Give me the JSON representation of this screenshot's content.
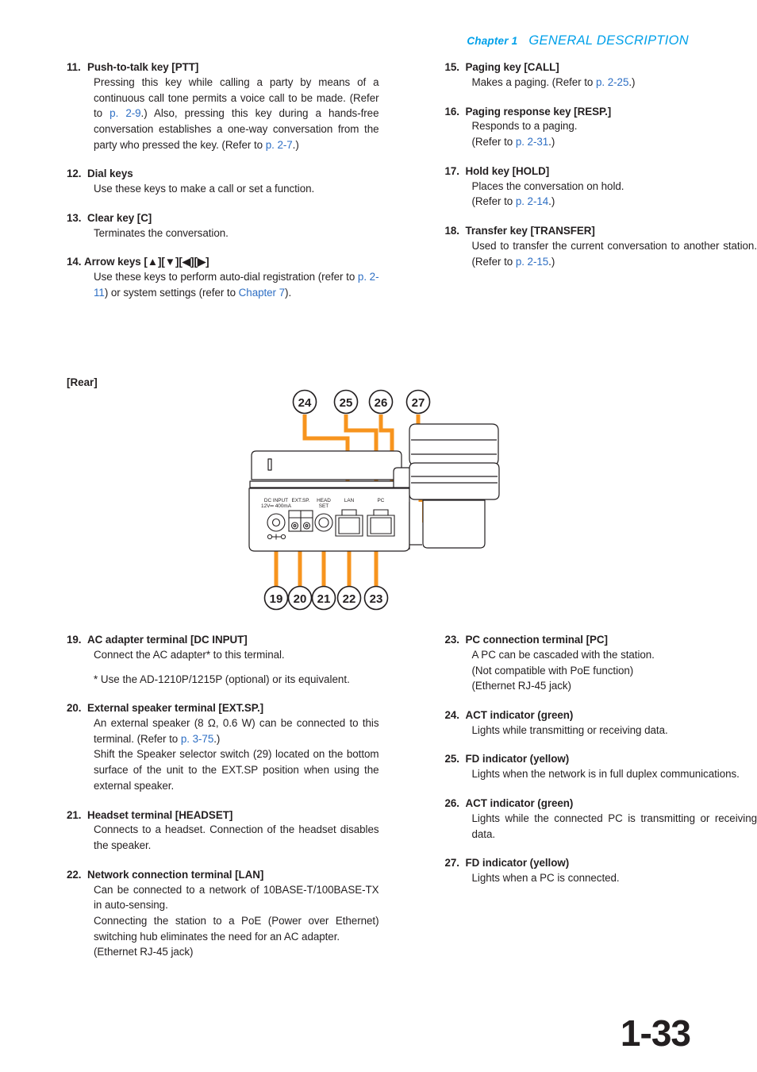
{
  "header": {
    "chapter": "Chapter 1",
    "title": "GENERAL DESCRIPTION"
  },
  "page_number": "1-33",
  "rear_label": "[Rear]",
  "left_column_top": [
    {
      "num": "11.",
      "title": "Push-to-talk key [PTT]",
      "body_parts": [
        {
          "t": "Pressing this key while calling a party by means of a continuous call tone permits a voice call to be made. (Refer to "
        },
        {
          "t": "p. 2-9",
          "link": true
        },
        {
          "t": ".) Also, pressing this key during a hands-free conversation establishes a one-way conversation from the party who pressed the key. (Refer to "
        },
        {
          "t": "p. 2-7",
          "link": true
        },
        {
          "t": ".)"
        }
      ]
    },
    {
      "num": "12.",
      "title": "Dial keys",
      "body_parts": [
        {
          "t": "Use these keys to make a call or set a function."
        }
      ]
    },
    {
      "num": "13.",
      "title": "Clear key [C]",
      "body_parts": [
        {
          "t": "Terminates the conversation."
        }
      ]
    },
    {
      "num": "14.",
      "title": "Arrow keys [▲][▼][◀][▶]",
      "tight": true,
      "body_parts": [
        {
          "t": "Use these keys to perform auto-dial registration (refer to "
        },
        {
          "t": "p. 2-11",
          "link": true
        },
        {
          "t": ") or system settings (refer to "
        },
        {
          "t": "Chapter 7",
          "link": true
        },
        {
          "t": ")."
        }
      ]
    }
  ],
  "right_column_top": [
    {
      "num": "15.",
      "title": "Paging key [CALL]",
      "body_parts": [
        {
          "t": "Makes a paging. (Refer to "
        },
        {
          "t": "p. 2-25",
          "link": true
        },
        {
          "t": ".)"
        }
      ]
    },
    {
      "num": "16.",
      "title": "Paging response key [RESP.]",
      "lines": [
        [
          {
            "t": "Responds to a paging."
          }
        ],
        [
          {
            "t": "(Refer to "
          },
          {
            "t": "p. 2-31",
            "link": true
          },
          {
            "t": ".)"
          }
        ]
      ]
    },
    {
      "num": "17.",
      "title": "Hold key [HOLD]",
      "lines": [
        [
          {
            "t": "Places the conversation on hold."
          }
        ],
        [
          {
            "t": "(Refer to "
          },
          {
            "t": "p. 2-14",
            "link": true
          },
          {
            "t": ".)"
          }
        ]
      ]
    },
    {
      "num": "18.",
      "title": "Transfer key [TRANSFER]",
      "body_parts": [
        {
          "t": "Used to transfer the current conversation to another station. (Refer to "
        },
        {
          "t": "p. 2-15",
          "link": true
        },
        {
          "t": ".)"
        }
      ]
    }
  ],
  "left_column_bottom": [
    {
      "num": "19.",
      "title": "AC adapter terminal [DC INPUT]",
      "body_parts": [
        {
          "t": "Connect the AC adapter* to this terminal."
        }
      ],
      "note": "* Use the AD-1210P/1215P (optional) or its equivalent."
    },
    {
      "num": "20.",
      "title": "External speaker terminal [EXT.SP.]",
      "lines": [
        [
          {
            "t": "An external speaker (8 Ω, 0.6 W) can be connected to this terminal. (Refer to "
          },
          {
            "t": "p. 3-75",
            "link": true
          },
          {
            "t": ".)"
          }
        ],
        [
          {
            "t": "Shift the Speaker selector switch (29) located on the bottom surface of the unit to the EXT.SP position when using the external speaker."
          }
        ]
      ]
    },
    {
      "num": "21.",
      "title": "Headset terminal [HEADSET]",
      "body_parts": [
        {
          "t": "Connects to a headset. Connection of the headset disables the speaker."
        }
      ]
    },
    {
      "num": "22.",
      "title": "Network connection terminal [LAN]",
      "lines": [
        [
          {
            "t": "Can be connected to a network of 10BASE-T/100BASE-TX in auto-sensing."
          }
        ],
        [
          {
            "t": "Connecting the station to a PoE (Power over Ethernet) switching hub eliminates the need for an AC adapter."
          }
        ],
        [
          {
            "t": "(Ethernet RJ-45 jack)"
          }
        ]
      ]
    }
  ],
  "right_column_bottom": [
    {
      "num": "23.",
      "title": "PC connection terminal [PC]",
      "lines": [
        [
          {
            "t": "A PC can be cascaded with the station."
          }
        ],
        [
          {
            "t": "(Not compatible with PoE function)"
          }
        ],
        [
          {
            "t": "(Ethernet RJ-45 jack)"
          }
        ]
      ]
    },
    {
      "num": "24.",
      "title": "ACT indicator (green)",
      "body_parts": [
        {
          "t": "Lights while transmitting or receiving data."
        }
      ]
    },
    {
      "num": "25.",
      "title": "FD indicator (yellow)",
      "body_parts": [
        {
          "t": "Lights when the network is in full duplex communications."
        }
      ]
    },
    {
      "num": "26.",
      "title": "ACT indicator (green)",
      "body_parts": [
        {
          "t": "Lights while the connected PC is transmitting or receiving data."
        }
      ]
    },
    {
      "num": "27.",
      "title": "FD indicator (yellow)",
      "body_parts": [
        {
          "t": "Lights when a PC is connected."
        }
      ]
    }
  ],
  "figure": {
    "callouts_top": [
      "24",
      "25",
      "26",
      "27"
    ],
    "callouts_bottom": [
      "19",
      "20",
      "21",
      "22",
      "23"
    ],
    "port_labels": [
      {
        "name": "dc-input",
        "line1": "DC INPUT",
        "line2": "12V═ 400mA"
      },
      {
        "name": "ext-sp",
        "line1": "EXT.SP.",
        "line2": ""
      },
      {
        "name": "headset",
        "line1": "HEAD",
        "line2": "SET"
      },
      {
        "name": "lan",
        "line1": "LAN",
        "line2": ""
      },
      {
        "name": "pc",
        "line1": "PC",
        "line2": ""
      }
    ],
    "leader_color": "#F7941E",
    "outline_color": "#231f20"
  }
}
